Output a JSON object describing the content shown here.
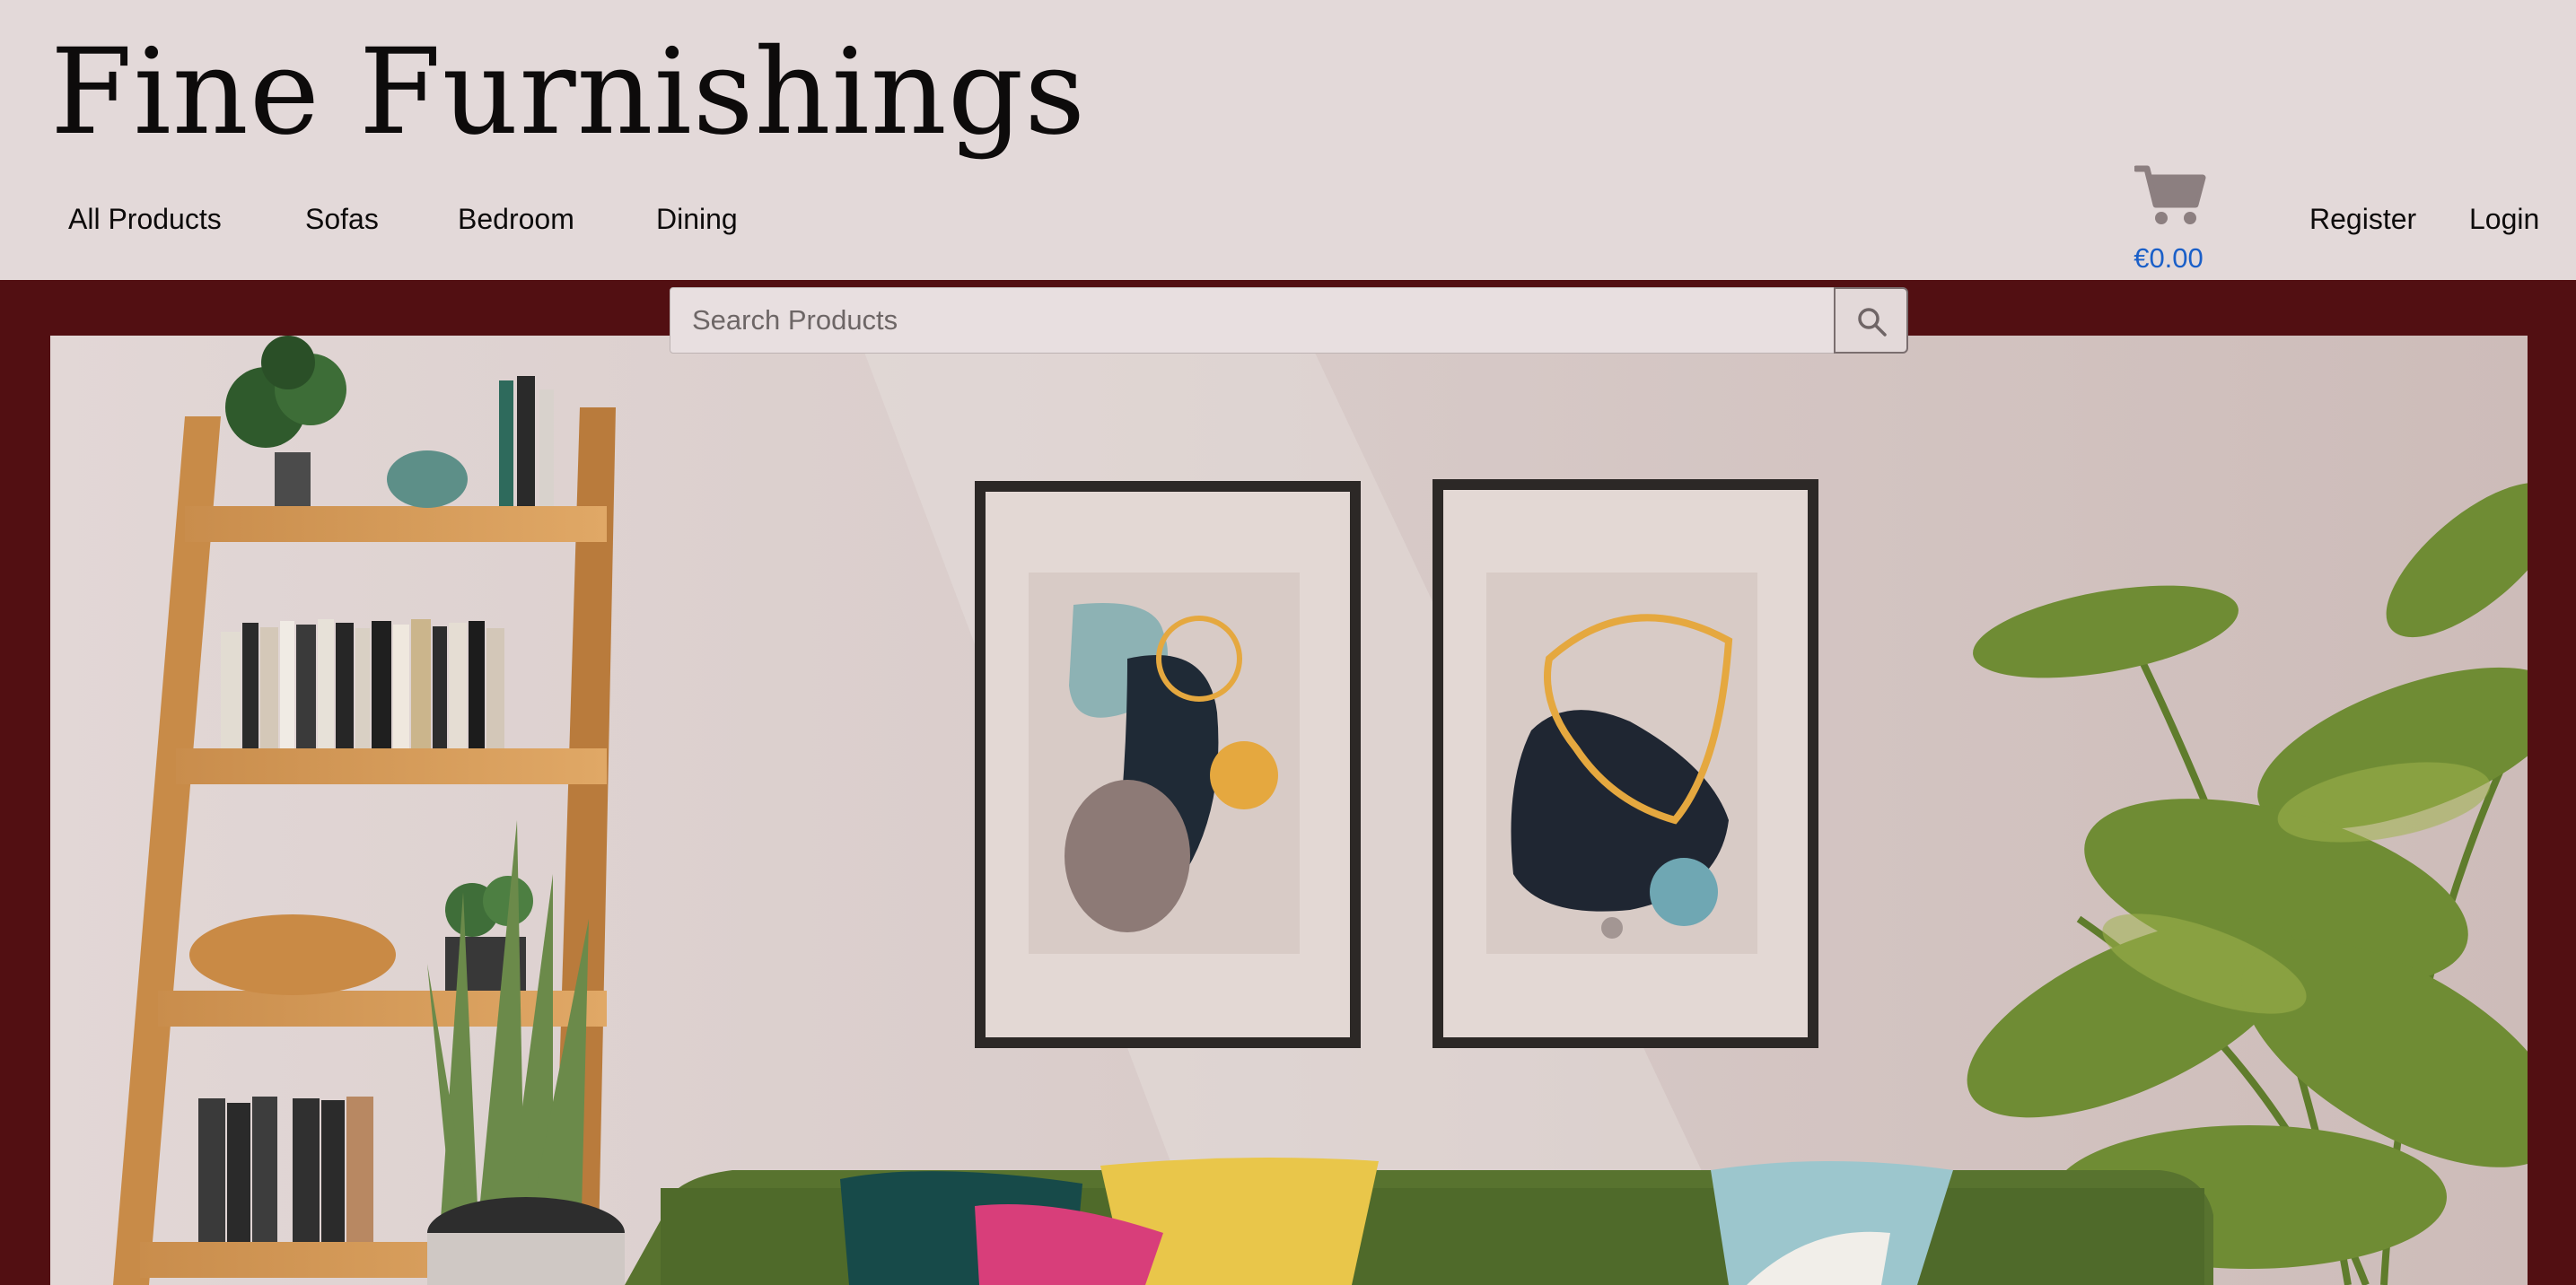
{
  "brand": {
    "name": "Fine Furnishings"
  },
  "nav": {
    "items": [
      {
        "label": "All Products"
      },
      {
        "label": "Sofas"
      },
      {
        "label": "Bedroom"
      },
      {
        "label": "Dining"
      }
    ]
  },
  "cart": {
    "icon": "cart-icon",
    "total": "€0.00"
  },
  "account": {
    "register_label": "Register",
    "login_label": "Login"
  },
  "search": {
    "placeholder": "Search Products",
    "value": "",
    "button_icon": "search-icon"
  },
  "hero": {
    "image": "living-room-scene"
  },
  "colors": {
    "header_bg": "#e3d9d9",
    "page_bg": "#520f12",
    "accent_link": "#1a5fc8"
  }
}
